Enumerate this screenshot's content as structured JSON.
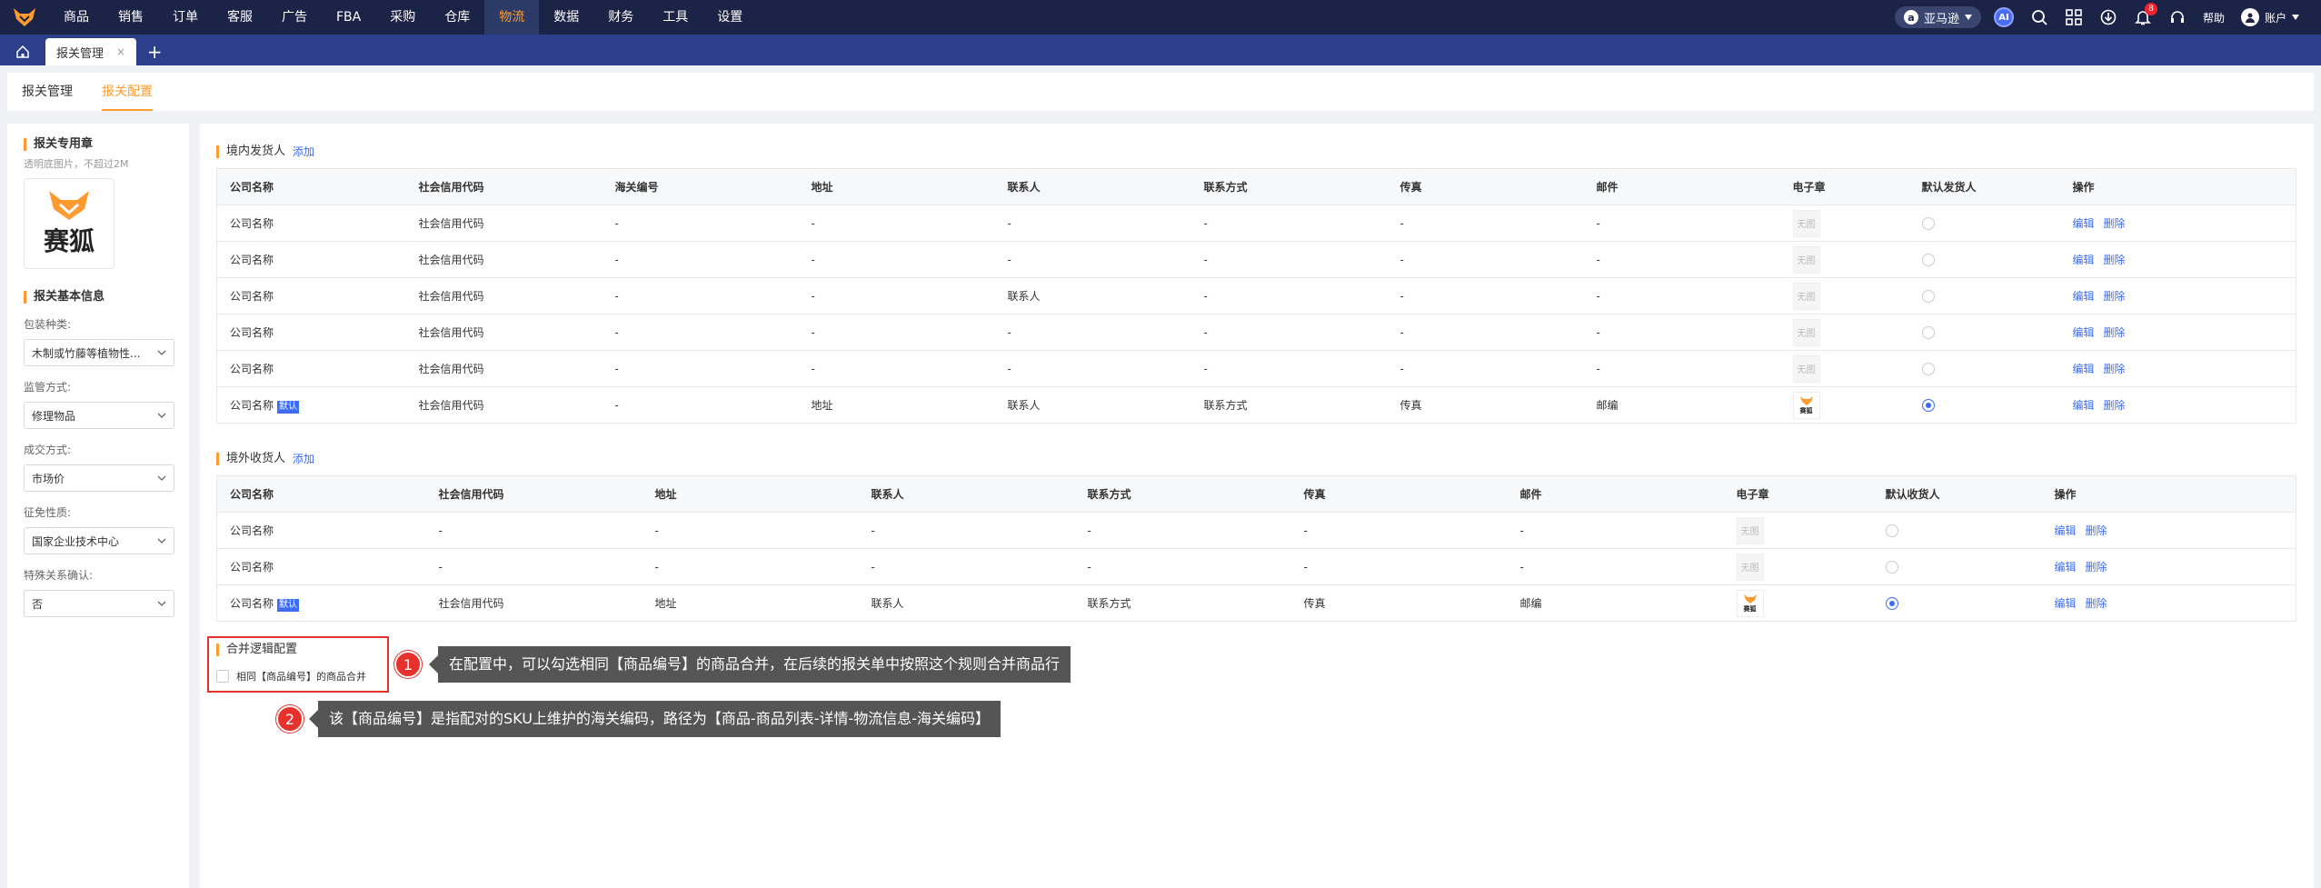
{
  "nav": {
    "items": [
      "商品",
      "销售",
      "订单",
      "客服",
      "广告",
      "FBA",
      "采购",
      "仓库",
      "物流",
      "数据",
      "财务",
      "工具",
      "设置"
    ],
    "active_index": 8,
    "store_name": "亚马逊",
    "ai_label": "AI",
    "notification_count": "8",
    "help_label": "帮助",
    "account_label": "账户"
  },
  "tabs": {
    "current": "报关管理",
    "close": "×",
    "add": "+"
  },
  "subtabs": [
    "报关管理",
    "报关配置"
  ],
  "left": {
    "seal_title": "报关专用章",
    "seal_hint": "透明底图片，不超过2M",
    "seal_text": "赛狐",
    "basic_title": "报关基本信息",
    "fields": [
      {
        "label": "包装种类:",
        "value": "木制或竹藤等植物性..."
      },
      {
        "label": "监管方式:",
        "value": "修理物品"
      },
      {
        "label": "成交方式:",
        "value": "市场价"
      },
      {
        "label": "征免性质:",
        "value": "国家企业技术中心"
      },
      {
        "label": "特殊关系确认:",
        "value": "否"
      }
    ]
  },
  "domestic": {
    "title": "境内发货人",
    "add_label": "添加",
    "headers": [
      "公司名称",
      "社会信用代码",
      "海关编号",
      "地址",
      "联系人",
      "联系方式",
      "传真",
      "邮件",
      "电子章",
      "默认发货人",
      "操作"
    ],
    "rows": [
      [
        "公司名称",
        "社会信用代码",
        "-",
        "-",
        "-",
        "-",
        "-",
        "-"
      ],
      [
        "公司名称",
        "社会信用代码",
        "-",
        "-",
        "-",
        "-",
        "-",
        "-"
      ],
      [
        "公司名称",
        "社会信用代码",
        "-",
        "-",
        "联系人",
        "-",
        "-",
        "-"
      ],
      [
        "公司名称",
        "社会信用代码",
        "-",
        "-",
        "-",
        "-",
        "-",
        "-"
      ],
      [
        "公司名称",
        "社会信用代码",
        "-",
        "-",
        "-",
        "-",
        "-",
        "-"
      ],
      [
        "公司名称",
        "社会信用代码",
        "-",
        "地址",
        "联系人",
        "联系方式",
        "传真",
        "邮编"
      ]
    ],
    "default_row": 5
  },
  "overseas": {
    "title": "境外收货人",
    "add_label": "添加",
    "headers": [
      "公司名称",
      "社会信用代码",
      "地址",
      "联系人",
      "联系方式",
      "传真",
      "邮件",
      "电子章",
      "默认收货人",
      "操作"
    ],
    "rows": [
      [
        "公司名称",
        "-",
        "-",
        "-",
        "-",
        "-",
        "-"
      ],
      [
        "公司名称",
        "-",
        "-",
        "-",
        "-",
        "-",
        "-"
      ],
      [
        "公司名称",
        "社会信用代码",
        "地址",
        "联系人",
        "联系方式",
        "传真",
        "邮编"
      ]
    ],
    "default_row": 2
  },
  "common": {
    "no_seal": "无图",
    "seal_small": "赛狐",
    "default_tag": "默认",
    "edit": "编辑",
    "delete": "删除"
  },
  "merge": {
    "title": "合并逻辑配置",
    "checkbox_label": "相同【商品编号】的商品合并"
  },
  "callouts": [
    {
      "num": "1",
      "text": "在配置中，可以勾选相同【商品编号】的商品合并，在后续的报关单中按照这个规则合并商品行"
    },
    {
      "num": "2",
      "text": "该【商品编号】是指配对的SKU上维护的海关编码，路径为【商品-商品列表-详情-物流信息-海关编码】"
    }
  ]
}
